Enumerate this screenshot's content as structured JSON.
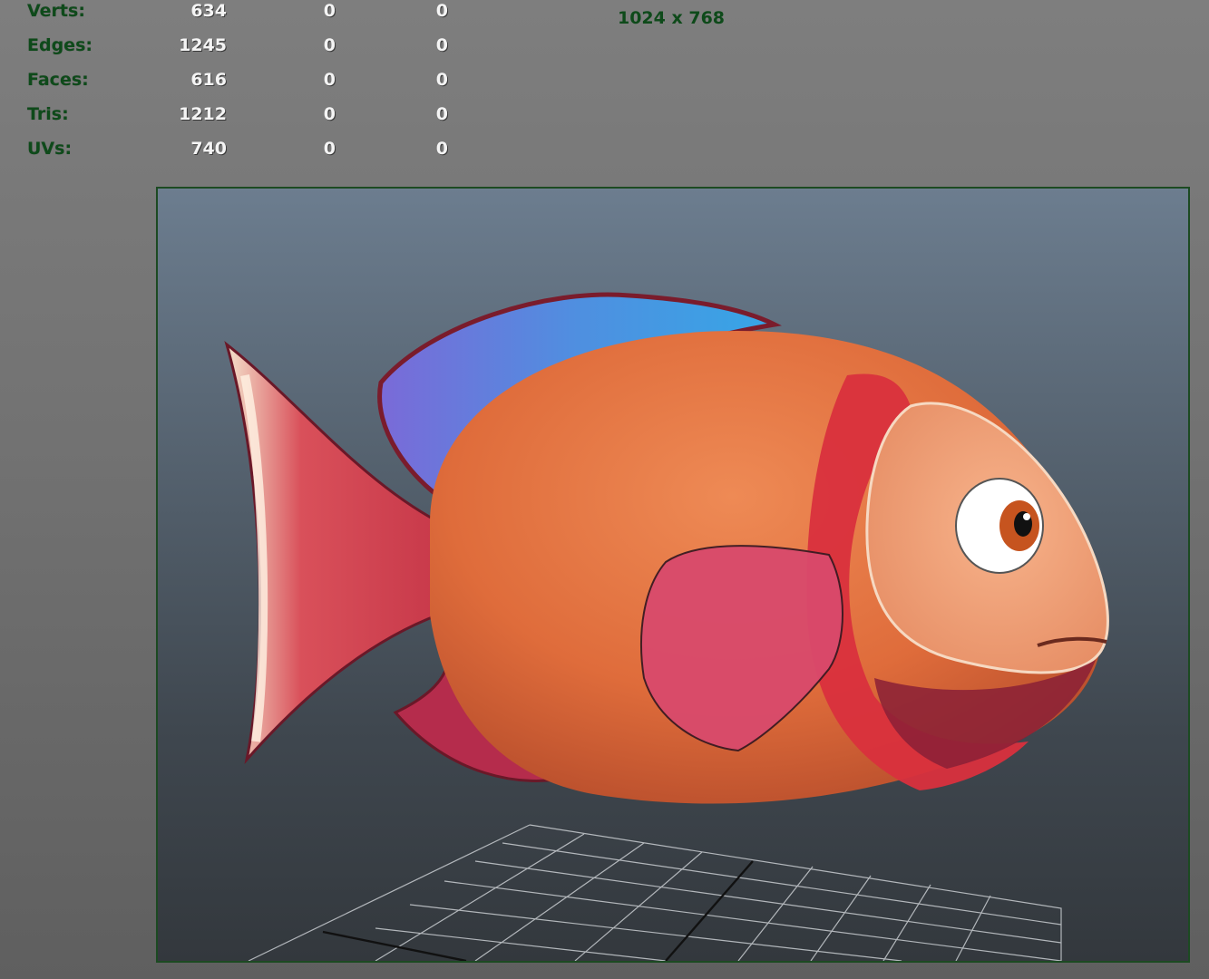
{
  "hud": {
    "rows": [
      {
        "label": "Verts:",
        "v1": "634",
        "v2": "0",
        "v3": "0"
      },
      {
        "label": "Edges:",
        "v1": "1245",
        "v2": "0",
        "v3": "0"
      },
      {
        "label": "Faces:",
        "v1": "616",
        "v2": "0",
        "v3": "0"
      },
      {
        "label": "Tris:",
        "v1": "1212",
        "v2": "0",
        "v3": "0"
      },
      {
        "label": "UVs:",
        "v1": "740",
        "v2": "0",
        "v3": "0"
      }
    ],
    "resolution": "1024 x 768"
  },
  "viewport": {
    "object_icon": "cartoon-fish-model",
    "colors": {
      "body": "#e0733f",
      "stripe": "#d9303d",
      "dorsal_fin": "#4f8fe0",
      "pectoral_fin": "#d94a6c",
      "tail": "#c8394a",
      "frame": "#1c4a22"
    }
  }
}
